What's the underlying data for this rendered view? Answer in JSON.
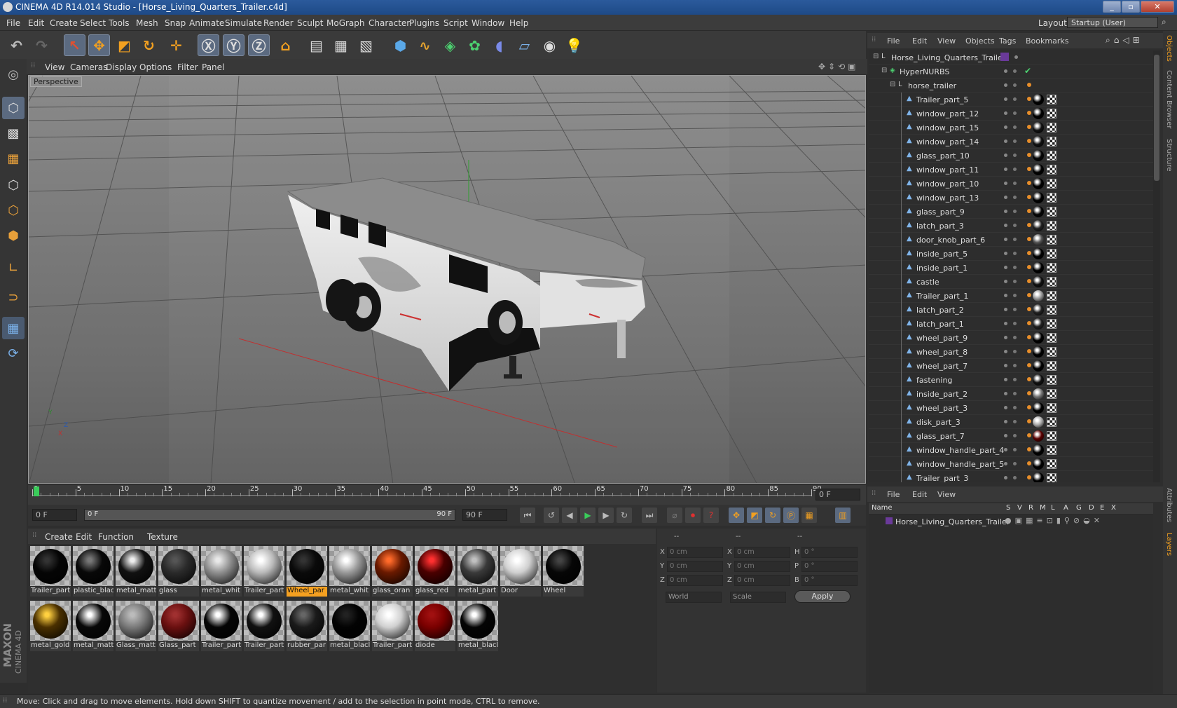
{
  "window": {
    "title": "CINEMA 4D R14.014 Studio - [Horse_Living_Quarters_Trailer.c4d]",
    "min": "_",
    "max": "▫",
    "close": "✕"
  },
  "menubar": [
    "File",
    "Edit",
    "Create",
    "Select",
    "Tools",
    "Mesh",
    "Snap",
    "Animate",
    "Simulate",
    "Render",
    "Sculpt",
    "MoGraph",
    "Character",
    "Plugins",
    "Script",
    "Window",
    "Help"
  ],
  "layout": {
    "label": "Layout:",
    "value": "Startup (User)"
  },
  "viewport": {
    "menu": [
      "View",
      "Cameras",
      "Display",
      "Options",
      "Filter",
      "Panel"
    ],
    "label": "Perspective",
    "axis_y": "Y",
    "axis_z": "Z",
    "axis_x": "X"
  },
  "timeline": {
    "ticks": [
      "0",
      "5",
      "10",
      "15",
      "20",
      "25",
      "30",
      "35",
      "40",
      "45",
      "50",
      "55",
      "60",
      "65",
      "70",
      "75",
      "80",
      "85",
      "90"
    ],
    "current_frame": "0 F",
    "start_field": "0 F",
    "range_start": "0 F",
    "range_end": "90 F",
    "end_field": "90 F"
  },
  "materials": {
    "menu": [
      "Create",
      "Edit",
      "Function",
      "Texture"
    ],
    "row1": [
      {
        "name": "Trailer_part",
        "color": "#050505",
        "hl": "#333333",
        "selected": false
      },
      {
        "name": "plastic_blac",
        "color": "#080808",
        "hl": "#777777",
        "selected": false
      },
      {
        "name": "metal_matt",
        "color": "#111111",
        "hl": "#eeeeee",
        "selected": false
      },
      {
        "name": "glass",
        "color": "#2a2a2a",
        "hl": "#555555",
        "selected": false
      },
      {
        "name": "metal_whit",
        "color": "#8f8f8f",
        "hl": "#e8e8e8",
        "selected": false
      },
      {
        "name": "Trailer_part",
        "color": "#b9b9b9",
        "hl": "#ffffff",
        "selected": false
      },
      {
        "name": "Wheel_par",
        "color": "#0a0a0a",
        "hl": "#333333",
        "selected": true
      },
      {
        "name": "metal_whit",
        "color": "#999999",
        "hl": "#ffffff",
        "selected": false
      },
      {
        "name": "glass_oran",
        "color": "#6a1a00",
        "hl": "#ff6a2a",
        "selected": false
      },
      {
        "name": "glass_red",
        "color": "#4a0000",
        "hl": "#ff3030",
        "selected": false
      },
      {
        "name": "metal_part",
        "color": "#3a3a3a",
        "hl": "#c0c0c0",
        "selected": false
      },
      {
        "name": "Door",
        "color": "#cfcfcf",
        "hl": "#ffffff",
        "selected": false
      },
      {
        "name": "Wheel",
        "color": "#060606",
        "hl": "#444444",
        "selected": false
      }
    ],
    "row2": [
      {
        "name": "metal_gold",
        "color": "#4a3000",
        "hl": "#ffd040",
        "selected": false
      },
      {
        "name": "metal_matt",
        "color": "#080808",
        "hl": "#ffffff",
        "selected": false
      },
      {
        "name": "Glass_matt",
        "color": "#7a7a7a",
        "hl": "#bbbbbb",
        "selected": false
      },
      {
        "name": "Glass_part",
        "color": "#6a1010",
        "hl": "#a03030",
        "selected": false
      },
      {
        "name": "Trailer_part",
        "color": "#050505",
        "hl": "#ffffff",
        "selected": false
      },
      {
        "name": "Trailer_part",
        "color": "#111111",
        "hl": "#ffffff",
        "selected": false
      },
      {
        "name": "rubber_par",
        "color": "#1a1a1a",
        "hl": "#666666",
        "selected": false
      },
      {
        "name": "metal_blacl",
        "color": "#030303",
        "hl": "#222222",
        "selected": false
      },
      {
        "name": "Trailer_part",
        "color": "#d0d0d0",
        "hl": "#ffffff",
        "selected": false
      },
      {
        "name": "diode",
        "color": "#7a0000",
        "hl": "#a01010",
        "selected": false
      },
      {
        "name": "metal_blacl",
        "color": "#040404",
        "hl": "#ffffff",
        "selected": false
      }
    ]
  },
  "attributes": {
    "header": [
      "--",
      "--",
      "--"
    ],
    "rows": [
      {
        "a": "X",
        "av": "0 cm",
        "b": "X",
        "bv": "0 cm",
        "c": "H",
        "cv": "0 °"
      },
      {
        "a": "Y",
        "av": "0 cm",
        "b": "Y",
        "bv": "0 cm",
        "c": "P",
        "cv": "0 °"
      },
      {
        "a": "Z",
        "av": "0 cm",
        "b": "Z",
        "bv": "0 cm",
        "c": "B",
        "cv": "0 °"
      }
    ],
    "world": "World",
    "scale": "Scale",
    "apply": "Apply"
  },
  "objects": {
    "menu": [
      "File",
      "Edit",
      "View",
      "Objects",
      "Tags",
      "Bookmarks"
    ],
    "root": "Horse_Living_Quarters_Trailer",
    "nurbs": "HyperNURBS",
    "group": "horse_trailer",
    "items": [
      {
        "name": "Trailer_part_5",
        "mat": "#000000"
      },
      {
        "name": "window_part_12",
        "mat": "#000000"
      },
      {
        "name": "window_part_15",
        "mat": "#111111"
      },
      {
        "name": "window_part_14",
        "mat": "#111111"
      },
      {
        "name": "glass_part_10",
        "mat": "#050505"
      },
      {
        "name": "window_part_11",
        "mat": "#000000"
      },
      {
        "name": "window_part_10",
        "mat": "#000000"
      },
      {
        "name": "window_part_13",
        "mat": "#000000"
      },
      {
        "name": "glass_part_9",
        "mat": "#050505"
      },
      {
        "name": "latch_part_3",
        "mat": "#222222"
      },
      {
        "name": "door_knob_part_6",
        "mat": "#555555"
      },
      {
        "name": "inside_part_5",
        "mat": "#000000"
      },
      {
        "name": "inside_part_1",
        "mat": "#000000"
      },
      {
        "name": "castle",
        "mat": "#111111"
      },
      {
        "name": "Trailer_part_1",
        "mat": "#999999"
      },
      {
        "name": "latch_part_2",
        "mat": "#222222"
      },
      {
        "name": "latch_part_1",
        "mat": "#222222"
      },
      {
        "name": "wheel_part_9",
        "mat": "#000000"
      },
      {
        "name": "wheel_part_8",
        "mat": "#000000"
      },
      {
        "name": "wheel_part_7",
        "mat": "#000000"
      },
      {
        "name": "fastening",
        "mat": "#111111"
      },
      {
        "name": "inside_part_2",
        "mat": "#777777"
      },
      {
        "name": "wheel_part_3",
        "mat": "#000000"
      },
      {
        "name": "disk_part_3",
        "mat": "#aaaaaa"
      },
      {
        "name": "glass_part_7",
        "mat": "#5a0000"
      },
      {
        "name": "window_handle_part_4",
        "mat": "#000000"
      },
      {
        "name": "window_handle_part_5",
        "mat": "#000000"
      },
      {
        "name": "Trailer_part_3",
        "mat": "#000000"
      }
    ]
  },
  "layers": {
    "menu": [
      "File",
      "Edit",
      "View"
    ],
    "columns": [
      "Name",
      "S",
      "V",
      "R",
      "M",
      "L",
      "A",
      "G",
      "D",
      "E",
      "X"
    ],
    "row": "Horse_Living_Quarters_Trailer"
  },
  "sidetabs": [
    "Objects",
    "Content Browser",
    "Structure",
    "Attributes",
    "Layers"
  ],
  "status": "Move: Click and drag to move elements. Hold down SHIFT to quantize movement / add to the selection in point mode, CTRL to remove.",
  "brand": {
    "maxon": "MAXON",
    "c4d": "CINEMA 4D"
  }
}
